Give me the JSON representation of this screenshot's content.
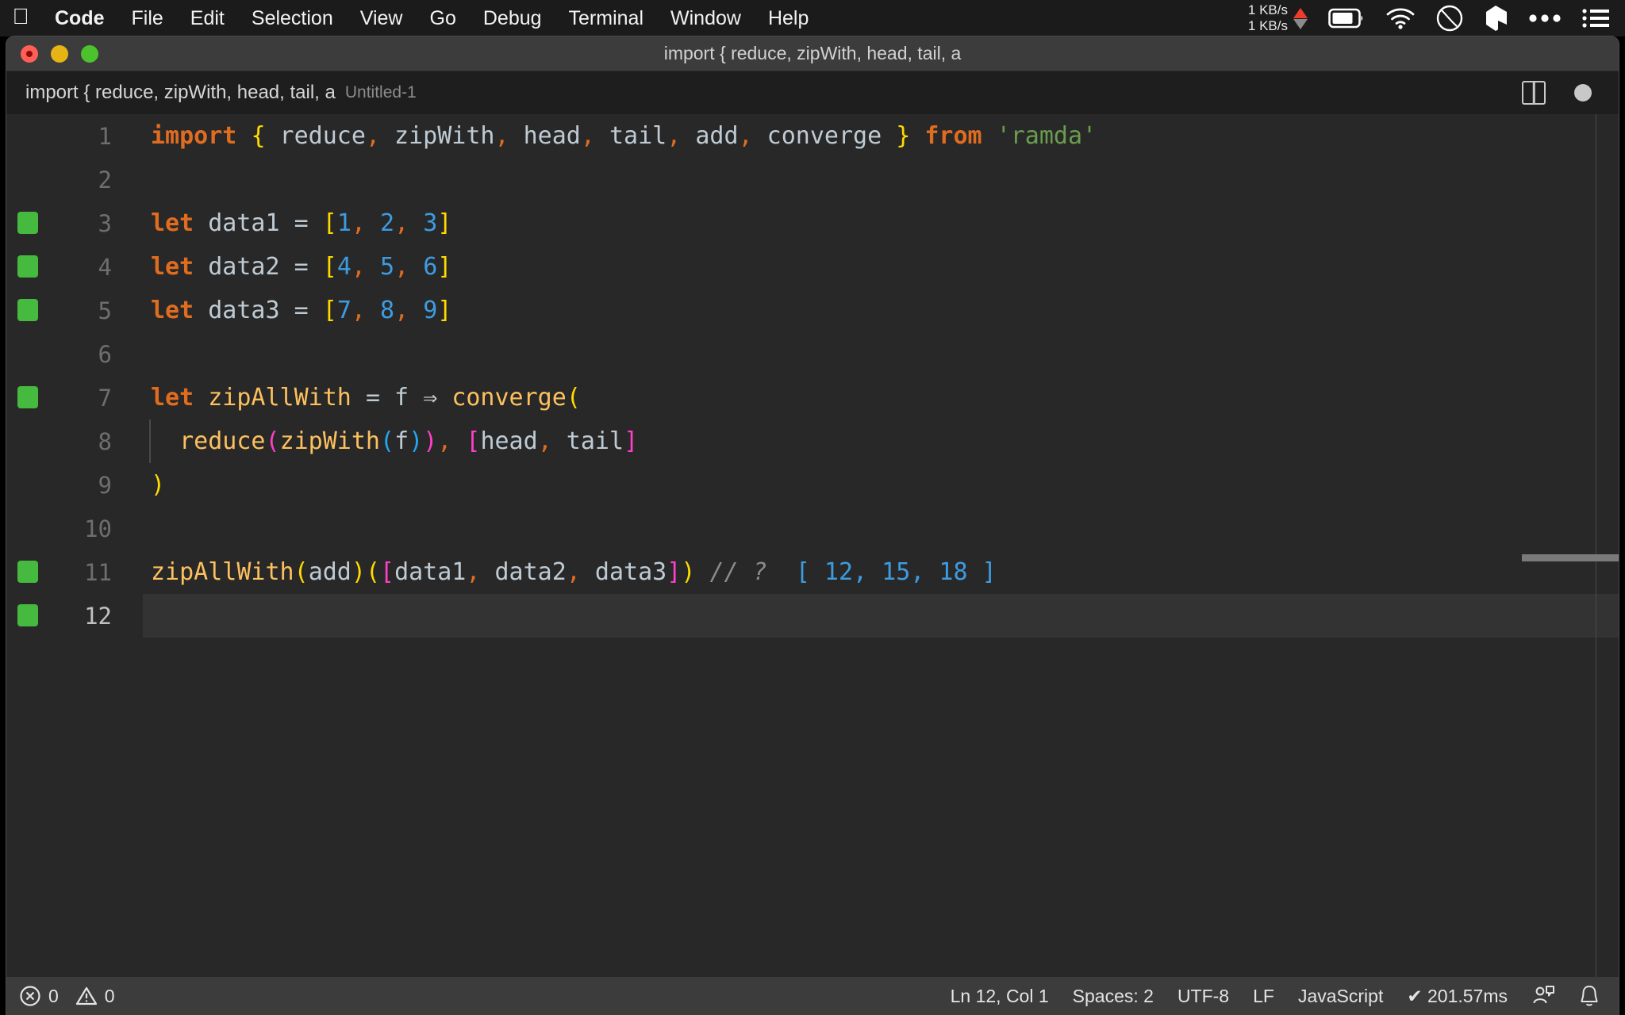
{
  "menubar": {
    "apple_icon": "apple-logo-icon",
    "items": [
      {
        "label": "Code",
        "bold": true
      },
      {
        "label": "File",
        "bold": false
      },
      {
        "label": "Edit",
        "bold": false
      },
      {
        "label": "Selection",
        "bold": false
      },
      {
        "label": "View",
        "bold": false
      },
      {
        "label": "Go",
        "bold": false
      },
      {
        "label": "Debug",
        "bold": false
      },
      {
        "label": "Terminal",
        "bold": false
      },
      {
        "label": "Window",
        "bold": false
      },
      {
        "label": "Help",
        "bold": false
      }
    ],
    "tray": {
      "net_up": "1 KB/s",
      "net_down": "1 KB/s",
      "icons": [
        "battery-icon",
        "wifi-icon",
        "clock-icon",
        "dropbox-icon",
        "ellipsis-icon",
        "list-icon"
      ]
    }
  },
  "window": {
    "title": "import { reduce, zipWith, head, tail, a",
    "traffic_lights": [
      "close-button",
      "minimize-button",
      "zoom-button"
    ]
  },
  "tabbar": {
    "tab_label": "import { reduce, zipWith, head, tail, a",
    "tab_description": "Untitled-1",
    "actions": [
      "split-editor-icon",
      "unsaved-indicator-icon"
    ]
  },
  "editor": {
    "lines": [
      {
        "number": "1",
        "marker": false,
        "active": false,
        "indent_guide": false,
        "tokens": [
          {
            "t": "import",
            "c": "kw"
          },
          {
            "t": " ",
            "c": "plain"
          },
          {
            "t": "{",
            "c": "b1"
          },
          {
            "t": " reduce",
            "c": "plain"
          },
          {
            "t": ",",
            "c": "punc"
          },
          {
            "t": " zipWith",
            "c": "plain"
          },
          {
            "t": ",",
            "c": "punc"
          },
          {
            "t": " head",
            "c": "plain"
          },
          {
            "t": ",",
            "c": "punc"
          },
          {
            "t": " tail",
            "c": "plain"
          },
          {
            "t": ",",
            "c": "punc"
          },
          {
            "t": " add",
            "c": "plain"
          },
          {
            "t": ",",
            "c": "punc"
          },
          {
            "t": " converge ",
            "c": "plain"
          },
          {
            "t": "}",
            "c": "b1"
          },
          {
            "t": " ",
            "c": "plain"
          },
          {
            "t": "from",
            "c": "kw"
          },
          {
            "t": " ",
            "c": "plain"
          },
          {
            "t": "'ramda'",
            "c": "str"
          }
        ]
      },
      {
        "number": "2",
        "marker": false,
        "active": false,
        "indent_guide": false,
        "tokens": []
      },
      {
        "number": "3",
        "marker": true,
        "active": false,
        "indent_guide": false,
        "tokens": [
          {
            "t": "let",
            "c": "kw"
          },
          {
            "t": " data1 ",
            "c": "plain"
          },
          {
            "t": "=",
            "c": "op"
          },
          {
            "t": " ",
            "c": "plain"
          },
          {
            "t": "[",
            "c": "b1"
          },
          {
            "t": "1",
            "c": "num"
          },
          {
            "t": ",",
            "c": "punc"
          },
          {
            "t": " ",
            "c": "plain"
          },
          {
            "t": "2",
            "c": "num"
          },
          {
            "t": ",",
            "c": "punc"
          },
          {
            "t": " ",
            "c": "plain"
          },
          {
            "t": "3",
            "c": "num"
          },
          {
            "t": "]",
            "c": "b1"
          }
        ]
      },
      {
        "number": "4",
        "marker": true,
        "active": false,
        "indent_guide": false,
        "tokens": [
          {
            "t": "let",
            "c": "kw"
          },
          {
            "t": " data2 ",
            "c": "plain"
          },
          {
            "t": "=",
            "c": "op"
          },
          {
            "t": " ",
            "c": "plain"
          },
          {
            "t": "[",
            "c": "b1"
          },
          {
            "t": "4",
            "c": "num"
          },
          {
            "t": ",",
            "c": "punc"
          },
          {
            "t": " ",
            "c": "plain"
          },
          {
            "t": "5",
            "c": "num"
          },
          {
            "t": ",",
            "c": "punc"
          },
          {
            "t": " ",
            "c": "plain"
          },
          {
            "t": "6",
            "c": "num"
          },
          {
            "t": "]",
            "c": "b1"
          }
        ]
      },
      {
        "number": "5",
        "marker": true,
        "active": false,
        "indent_guide": false,
        "tokens": [
          {
            "t": "let",
            "c": "kw"
          },
          {
            "t": " data3 ",
            "c": "plain"
          },
          {
            "t": "=",
            "c": "op"
          },
          {
            "t": " ",
            "c": "plain"
          },
          {
            "t": "[",
            "c": "b1"
          },
          {
            "t": "7",
            "c": "num"
          },
          {
            "t": ",",
            "c": "punc"
          },
          {
            "t": " ",
            "c": "plain"
          },
          {
            "t": "8",
            "c": "num"
          },
          {
            "t": ",",
            "c": "punc"
          },
          {
            "t": " ",
            "c": "plain"
          },
          {
            "t": "9",
            "c": "num"
          },
          {
            "t": "]",
            "c": "b1"
          }
        ]
      },
      {
        "number": "6",
        "marker": false,
        "active": false,
        "indent_guide": false,
        "tokens": []
      },
      {
        "number": "7",
        "marker": true,
        "active": false,
        "indent_guide": false,
        "tokens": [
          {
            "t": "let",
            "c": "kw"
          },
          {
            "t": " ",
            "c": "plain"
          },
          {
            "t": "zipAllWith",
            "c": "fn"
          },
          {
            "t": " ",
            "c": "plain"
          },
          {
            "t": "=",
            "c": "op"
          },
          {
            "t": " f ",
            "c": "plain"
          },
          {
            "t": "⇒",
            "c": "op"
          },
          {
            "t": " ",
            "c": "plain"
          },
          {
            "t": "converge",
            "c": "fn"
          },
          {
            "t": "(",
            "c": "b1"
          }
        ]
      },
      {
        "number": "8",
        "marker": false,
        "active": false,
        "indent_guide": true,
        "tokens": [
          {
            "t": "  ",
            "c": "plain"
          },
          {
            "t": "reduce",
            "c": "fn"
          },
          {
            "t": "(",
            "c": "b2"
          },
          {
            "t": "zipWith",
            "c": "fn"
          },
          {
            "t": "(",
            "c": "b3"
          },
          {
            "t": "f",
            "c": "plain"
          },
          {
            "t": ")",
            "c": "b3"
          },
          {
            "t": ")",
            "c": "b2"
          },
          {
            "t": ",",
            "c": "punc"
          },
          {
            "t": " ",
            "c": "plain"
          },
          {
            "t": "[",
            "c": "b2"
          },
          {
            "t": "head",
            "c": "plain"
          },
          {
            "t": ",",
            "c": "punc"
          },
          {
            "t": " tail",
            "c": "plain"
          },
          {
            "t": "]",
            "c": "b2"
          }
        ]
      },
      {
        "number": "9",
        "marker": false,
        "active": false,
        "indent_guide": false,
        "tokens": [
          {
            "t": ")",
            "c": "b1"
          }
        ]
      },
      {
        "number": "10",
        "marker": false,
        "active": false,
        "indent_guide": false,
        "tokens": []
      },
      {
        "number": "11",
        "marker": true,
        "active": false,
        "indent_guide": false,
        "tokens": [
          {
            "t": "zipAllWith",
            "c": "fn"
          },
          {
            "t": "(",
            "c": "b1"
          },
          {
            "t": "add",
            "c": "plain"
          },
          {
            "t": ")",
            "c": "b1"
          },
          {
            "t": "(",
            "c": "b1"
          },
          {
            "t": "[",
            "c": "b2"
          },
          {
            "t": "data1",
            "c": "plain"
          },
          {
            "t": ",",
            "c": "punc"
          },
          {
            "t": " data2",
            "c": "plain"
          },
          {
            "t": ",",
            "c": "punc"
          },
          {
            "t": " data3",
            "c": "plain"
          },
          {
            "t": "]",
            "c": "b2"
          },
          {
            "t": ")",
            "c": "b1"
          },
          {
            "t": " ",
            "c": "plain"
          },
          {
            "t": "// ?",
            "c": "com"
          },
          {
            "t": "  ",
            "c": "plain"
          },
          {
            "t": "[ 12, 15, 18 ]",
            "c": "quokka"
          }
        ]
      },
      {
        "number": "12",
        "marker": true,
        "active": true,
        "indent_guide": false,
        "tokens": []
      }
    ]
  },
  "statusbar": {
    "errors_icon": "error-circle-icon",
    "errors_count": "0",
    "warnings_icon": "warning-triangle-icon",
    "warnings_count": "0",
    "cursor_position": "Ln 12, Col 1",
    "indentation": "Spaces: 2",
    "encoding": "UTF-8",
    "eol": "LF",
    "language": "JavaScript",
    "quokka_status": "✔ 201.57ms",
    "feedback_icon": "feedback-person-icon",
    "bell_icon": "bell-icon"
  }
}
